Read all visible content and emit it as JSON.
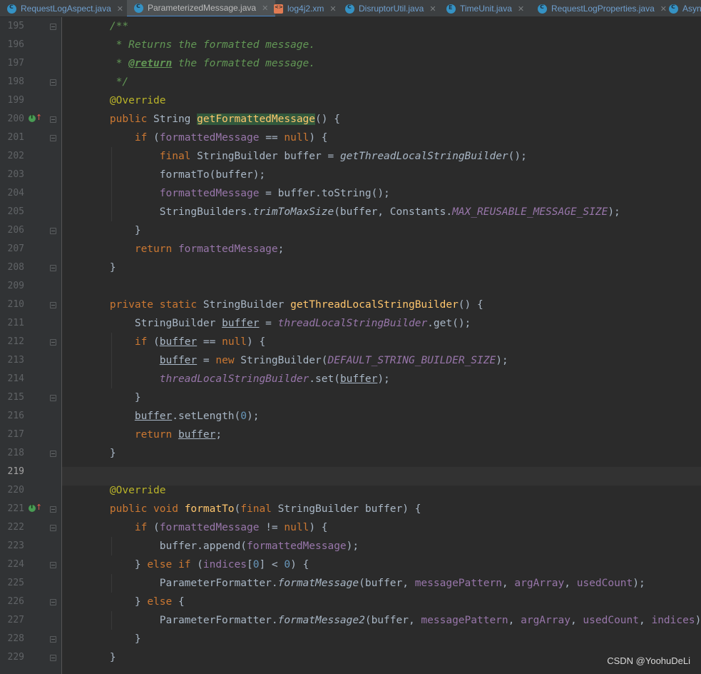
{
  "tabs": [
    {
      "label": "RequestLogAspect.java",
      "icon": "class-icon",
      "active": false
    },
    {
      "label": "ParameterizedMessage.java",
      "icon": "class-icon",
      "active": true
    },
    {
      "label": "log4j2.xm",
      "icon": "xml-file-icon",
      "active": false
    },
    {
      "label": "DisruptorUtil.java",
      "icon": "class-icon",
      "active": false
    },
    {
      "label": "TimeUnit.java",
      "icon": "enum-icon",
      "active": false
    },
    {
      "label": "RequestLogProperties.java",
      "icon": "class-icon",
      "active": false
    },
    {
      "label": "Asyn",
      "icon": "class-icon",
      "active": false
    }
  ],
  "editor": {
    "current_line": 219,
    "lines": [
      {
        "n": 195,
        "t": [
          [
            "    /**",
            "cm"
          ]
        ]
      },
      {
        "n": 196,
        "t": [
          [
            "     * Returns the formatted message.",
            "cm"
          ]
        ]
      },
      {
        "n": 197,
        "t": [
          [
            "     * ",
            "cm"
          ],
          [
            "@return",
            "tag"
          ],
          [
            " the formatted message.",
            "cm"
          ]
        ]
      },
      {
        "n": 198,
        "t": [
          [
            "     */",
            "cm"
          ]
        ]
      },
      {
        "n": 199,
        "t": [
          [
            "    ",
            ""
          ],
          [
            "@Override",
            "an"
          ]
        ]
      },
      {
        "n": 200,
        "t": [
          [
            "    ",
            ""
          ],
          [
            "public ",
            "kw"
          ],
          [
            "String ",
            ""
          ],
          [
            "getFormattedMessage",
            "fn hl"
          ],
          [
            "() {",
            ""
          ]
        ]
      },
      {
        "n": 201,
        "t": [
          [
            "        ",
            ""
          ],
          [
            "if ",
            "kw"
          ],
          [
            "(",
            ""
          ],
          [
            "formattedMessage",
            "fld"
          ],
          [
            " == ",
            ""
          ],
          [
            "null",
            "kw"
          ],
          [
            ") {",
            ""
          ]
        ]
      },
      {
        "n": 202,
        "t": [
          [
            "            ",
            ""
          ],
          [
            "final ",
            "kw"
          ],
          [
            "StringBuilder buffer = ",
            ""
          ],
          [
            "getThreadLocalStringBuilder",
            "st"
          ],
          [
            "();",
            ""
          ]
        ]
      },
      {
        "n": 203,
        "t": [
          [
            "            formatTo(buffer);",
            ""
          ]
        ]
      },
      {
        "n": 204,
        "t": [
          [
            "            ",
            ""
          ],
          [
            "formattedMessage",
            "fld"
          ],
          [
            " = buffer.toString();",
            ""
          ]
        ]
      },
      {
        "n": 205,
        "t": [
          [
            "            StringBuilders.",
            ""
          ],
          [
            "trimToMaxSize",
            "st"
          ],
          [
            "(buffer, Constants.",
            ""
          ],
          [
            "MAX_REUSABLE_MESSAGE_SIZE",
            "sfld"
          ],
          [
            ");",
            ""
          ]
        ]
      },
      {
        "n": 206,
        "t": [
          [
            "        }",
            ""
          ]
        ]
      },
      {
        "n": 207,
        "t": [
          [
            "        ",
            ""
          ],
          [
            "return ",
            "kw"
          ],
          [
            "formattedMessage",
            "fld"
          ],
          [
            ";",
            ""
          ]
        ]
      },
      {
        "n": 208,
        "t": [
          [
            "    }",
            ""
          ]
        ]
      },
      {
        "n": 209,
        "t": []
      },
      {
        "n": 210,
        "t": [
          [
            "    ",
            ""
          ],
          [
            "private static ",
            "kw"
          ],
          [
            "StringBuilder ",
            ""
          ],
          [
            "getThreadLocalStringBuilder",
            "fn"
          ],
          [
            "() {",
            ""
          ]
        ]
      },
      {
        "n": 211,
        "t": [
          [
            "        StringBuilder ",
            ""
          ],
          [
            "buffer",
            "u"
          ],
          [
            " = ",
            ""
          ],
          [
            "threadLocalStringBuilder",
            "sfld"
          ],
          [
            ".get();",
            ""
          ]
        ]
      },
      {
        "n": 212,
        "t": [
          [
            "        ",
            ""
          ],
          [
            "if ",
            "kw"
          ],
          [
            "(",
            ""
          ],
          [
            "buffer",
            "u"
          ],
          [
            " == ",
            ""
          ],
          [
            "null",
            "kw"
          ],
          [
            ") {",
            ""
          ]
        ]
      },
      {
        "n": 213,
        "t": [
          [
            "            ",
            ""
          ],
          [
            "buffer",
            "u"
          ],
          [
            " = ",
            ""
          ],
          [
            "new ",
            "kw"
          ],
          [
            "StringBuilder(",
            ""
          ],
          [
            "DEFAULT_STRING_BUILDER_SIZE",
            "sfld"
          ],
          [
            ");",
            ""
          ]
        ]
      },
      {
        "n": 214,
        "t": [
          [
            "            ",
            ""
          ],
          [
            "threadLocalStringBuilder",
            "sfld"
          ],
          [
            ".set(",
            ""
          ],
          [
            "buffer",
            "u"
          ],
          [
            ");",
            ""
          ]
        ]
      },
      {
        "n": 215,
        "t": [
          [
            "        }",
            ""
          ]
        ]
      },
      {
        "n": 216,
        "t": [
          [
            "        ",
            ""
          ],
          [
            "buffer",
            "u"
          ],
          [
            ".setLength(",
            ""
          ],
          [
            "0",
            "num"
          ],
          [
            ");",
            ""
          ]
        ]
      },
      {
        "n": 217,
        "t": [
          [
            "        ",
            ""
          ],
          [
            "return ",
            "kw"
          ],
          [
            "buffer",
            "u"
          ],
          [
            ";",
            ""
          ]
        ]
      },
      {
        "n": 218,
        "t": [
          [
            "    }",
            ""
          ]
        ]
      },
      {
        "n": 219,
        "t": []
      },
      {
        "n": 220,
        "t": [
          [
            "    ",
            ""
          ],
          [
            "@Override",
            "an"
          ]
        ]
      },
      {
        "n": 221,
        "t": [
          [
            "    ",
            ""
          ],
          [
            "public void ",
            "kw"
          ],
          [
            "formatTo",
            "fn"
          ],
          [
            "(",
            ""
          ],
          [
            "final ",
            "kw"
          ],
          [
            "StringBuilder buffer) {",
            ""
          ]
        ]
      },
      {
        "n": 222,
        "t": [
          [
            "        ",
            ""
          ],
          [
            "if ",
            "kw"
          ],
          [
            "(",
            ""
          ],
          [
            "formattedMessage",
            "fld"
          ],
          [
            " != ",
            ""
          ],
          [
            "null",
            "kw"
          ],
          [
            ") {",
            ""
          ]
        ]
      },
      {
        "n": 223,
        "t": [
          [
            "            buffer.append(",
            ""
          ],
          [
            "formattedMessage",
            "fld"
          ],
          [
            ");",
            ""
          ]
        ]
      },
      {
        "n": 224,
        "t": [
          [
            "        } ",
            ""
          ],
          [
            "else if ",
            "kw"
          ],
          [
            "(",
            ""
          ],
          [
            "indices",
            "fld"
          ],
          [
            "[",
            ""
          ],
          [
            "0",
            "num"
          ],
          [
            "] < ",
            ""
          ],
          [
            "0",
            "num"
          ],
          [
            ") {",
            ""
          ]
        ]
      },
      {
        "n": 225,
        "t": [
          [
            "            ParameterFormatter.",
            ""
          ],
          [
            "formatMessage",
            "st"
          ],
          [
            "(buffer, ",
            ""
          ],
          [
            "messagePattern",
            "fld"
          ],
          [
            ", ",
            ""
          ],
          [
            "argArray",
            "fld"
          ],
          [
            ", ",
            ""
          ],
          [
            "usedCount",
            "fld"
          ],
          [
            ");",
            ""
          ]
        ]
      },
      {
        "n": 226,
        "t": [
          [
            "        } ",
            ""
          ],
          [
            "else ",
            "kw"
          ],
          [
            "{",
            ""
          ]
        ]
      },
      {
        "n": 227,
        "t": [
          [
            "            ParameterFormatter.",
            ""
          ],
          [
            "formatMessage2",
            "st"
          ],
          [
            "(buffer, ",
            ""
          ],
          [
            "messagePattern",
            "fld"
          ],
          [
            ", ",
            ""
          ],
          [
            "argArray",
            "fld"
          ],
          [
            ", ",
            ""
          ],
          [
            "usedCount",
            "fld"
          ],
          [
            ", ",
            ""
          ],
          [
            "indices",
            "fld"
          ],
          [
            ");",
            ""
          ]
        ]
      },
      {
        "n": 228,
        "t": [
          [
            "        }",
            ""
          ]
        ]
      },
      {
        "n": 229,
        "t": [
          [
            "    }",
            ""
          ]
        ]
      }
    ]
  },
  "watermark": "CSDN @YoohuDeLi",
  "colors": {
    "background": "#2b2b2b",
    "gutter": "#313335",
    "keyword": "#cc7832",
    "comment": "#629755",
    "annotation": "#bbb529",
    "method": "#ffc66d",
    "field": "#9876aa",
    "number": "#6897bb",
    "text": "#a9b7c6"
  }
}
